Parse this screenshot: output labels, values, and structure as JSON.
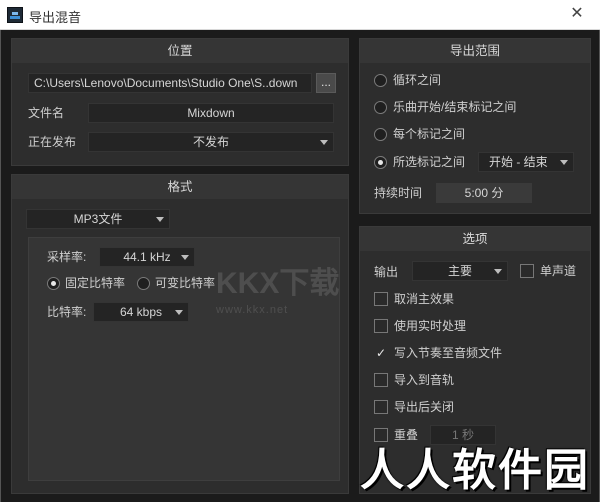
{
  "window": {
    "title": "导出混音"
  },
  "location": {
    "header": "位置",
    "path": "C:\\Users\\Lenovo\\Documents\\Studio One\\S..down",
    "browse_label": "...",
    "filename_label": "文件名",
    "filename_value": "Mixdown",
    "publish_label": "正在发布",
    "publish_value": "不发布"
  },
  "format": {
    "header": "格式",
    "type_value": "MP3文件",
    "sample_rate_label": "采样率:",
    "sample_rate_value": "44.1 kHz",
    "fixed_bitrate_label": "固定比特率",
    "variable_bitrate_label": "可变比特率",
    "bitrate_label": "比特率:",
    "bitrate_value": "64 kbps"
  },
  "export_range": {
    "header": "导出范围",
    "options": [
      "循环之间",
      "乐曲开始/结束标记之间",
      "每个标记之间",
      "所选标记之间"
    ],
    "selected_index": 3,
    "marker_value": "开始 - 结束",
    "duration_label": "持续时间",
    "duration_value": "5:00 分"
  },
  "options": {
    "header": "选项",
    "output_label": "输出",
    "output_value": "主要",
    "mono_label": "单声道",
    "mono_checked": false,
    "checkboxes": [
      {
        "label": "取消主效果",
        "checked": false
      },
      {
        "label": "使用实时处理",
        "checked": false
      },
      {
        "label": "写入节奏至音频文件",
        "checked": true
      },
      {
        "label": "导入到音轨",
        "checked": false
      },
      {
        "label": "导出后关闭",
        "checked": false
      }
    ],
    "overlap_label": "重叠",
    "overlap_value": "1 秒"
  },
  "watermarks": {
    "center_main": "KKX下载",
    "center_sub": "www.kkx.net",
    "corner": "人人软件园"
  },
  "colors": {
    "background": "#1b1b1b",
    "panel": "#2d2d2d",
    "panel_header": "#353535",
    "field": "#242424",
    "text": "#d6d6d6"
  },
  "icons": {
    "close": "close-icon",
    "app": "app-icon"
  }
}
